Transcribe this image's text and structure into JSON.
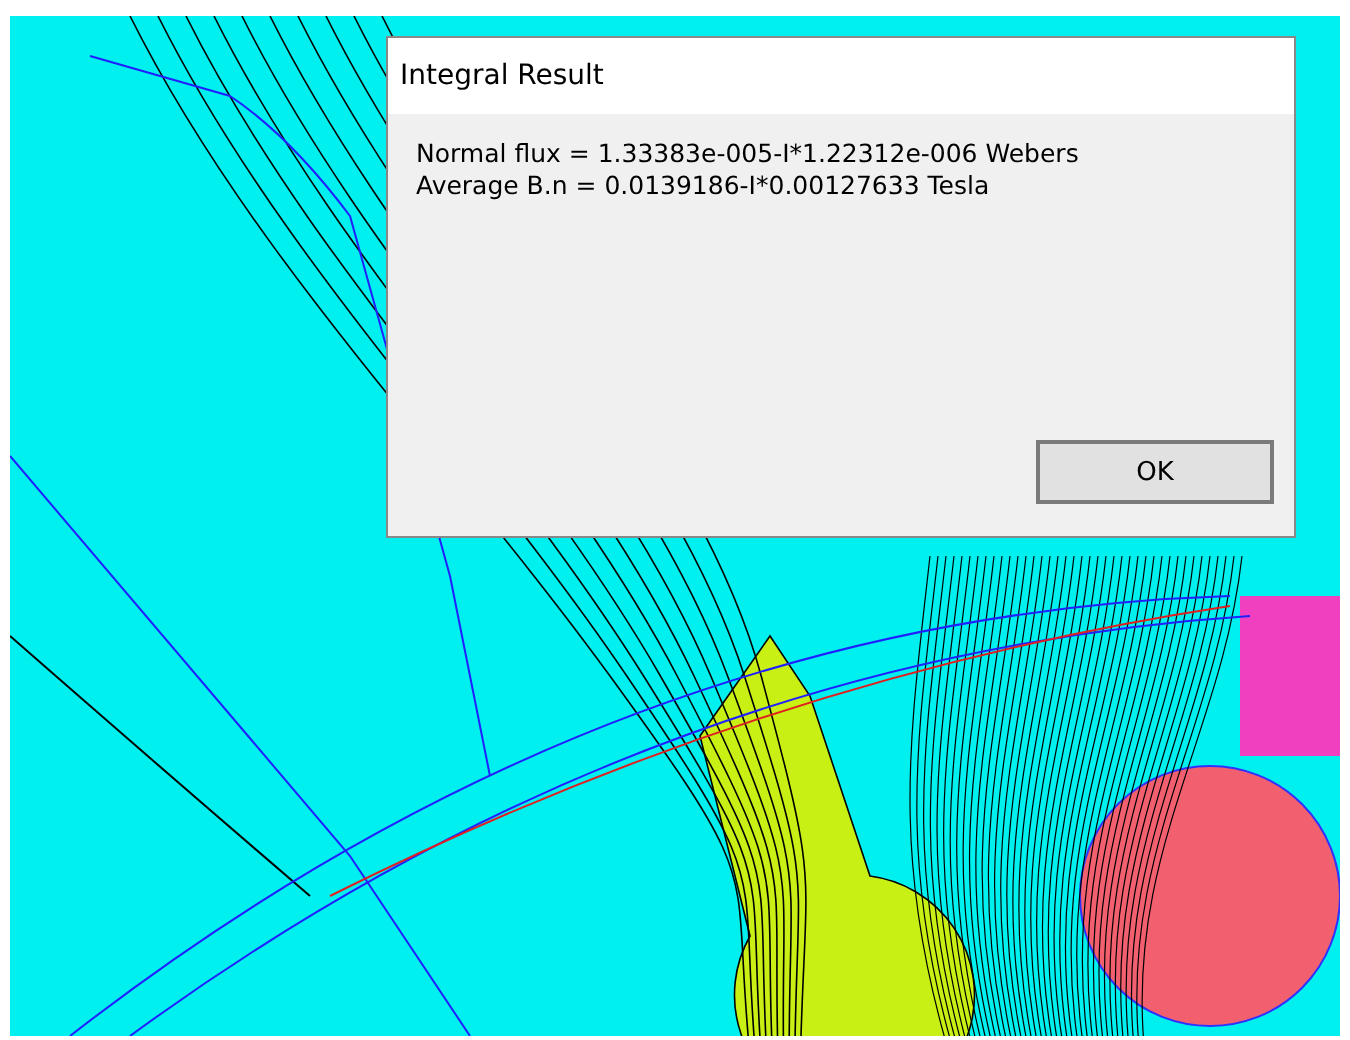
{
  "dialog": {
    "title": "Integral Result",
    "lines": [
      "Normal flux = 1.33383e-005-I*1.22312e-006 Webers",
      "Average B.n = 0.0139186-I*0.00127633 Tesla"
    ],
    "buttons": [
      "OK"
    ]
  }
}
